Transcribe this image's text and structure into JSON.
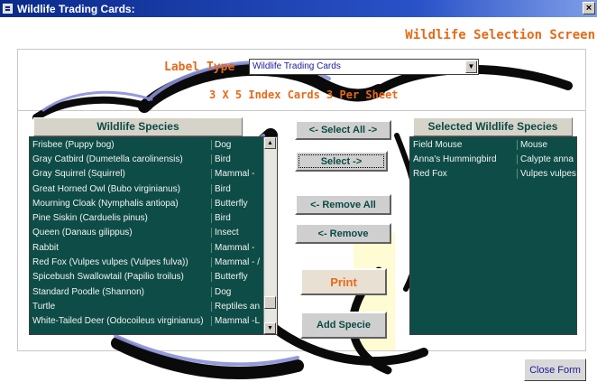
{
  "window": {
    "title": "Wildlife Trading Cards:",
    "close_glyph": "×"
  },
  "screen_title": "Wildlife Selection Screen",
  "label_type": {
    "label": "Label Type",
    "value": "Wildlife Trading Cards"
  },
  "sheet_info": "3 X 5 Index Cards 3 Per Sheet",
  "species_list": {
    "header": "Wildlife Species",
    "rows": [
      {
        "name": "Frisbee (Puppy bog)",
        "type": "Dog"
      },
      {
        "name": "Gray Catbird (Dumetella carolinensis)",
        "type": "Bird"
      },
      {
        "name": "Gray Squirrel (Squirrel)",
        "type": "Mammal -"
      },
      {
        "name": "Great Horned Owl (Bubo virginianus)",
        "type": "Bird"
      },
      {
        "name": "Mourning Cloak (Nymphalis antiopa)",
        "type": "Butterfly"
      },
      {
        "name": "Pine Siskin (Carduelis pinus)",
        "type": "Bird"
      },
      {
        "name": "Queen (Danaus gilippus)",
        "type": "Insect"
      },
      {
        "name": "Rabbit",
        "type": "Mammal -"
      },
      {
        "name": "Red Fox (Vulpes vulpes (Vulpes fulva))",
        "type": "Mammal - /"
      },
      {
        "name": "Spicebush Swallowtail (Papilio troilus)",
        "type": "Butterfly"
      },
      {
        "name": "Standard Poodle (Shannon)",
        "type": "Dog"
      },
      {
        "name": "Turtle",
        "type": "Reptiles an"
      },
      {
        "name": "White-Tailed Deer (Odocoileus virginianus)",
        "type": "Mammal -L"
      }
    ]
  },
  "selected_list": {
    "header": "Selected Wildlife Species",
    "rows": [
      {
        "name": "Field Mouse",
        "type": "Mouse"
      },
      {
        "name": "Anna's Hummingbird",
        "type": "Calypte anna"
      },
      {
        "name": "Red Fox",
        "type": "Vulpes vulpes"
      }
    ]
  },
  "buttons": {
    "select_all": "<- Select All ->",
    "select": "Select ->",
    "remove_all": "<- Remove All",
    "remove": "<- Remove",
    "print": "Print",
    "add_specie": "Add Specie",
    "close_form": "Close Form"
  },
  "scrollbar": {
    "up_glyph": "▲",
    "down_glyph": "▼"
  },
  "combo_arrow_glyph": "▼",
  "colors": {
    "accent_orange": "#e66a1a",
    "list_background": "#0e4d47",
    "title_bar": "#0a2a8a"
  }
}
